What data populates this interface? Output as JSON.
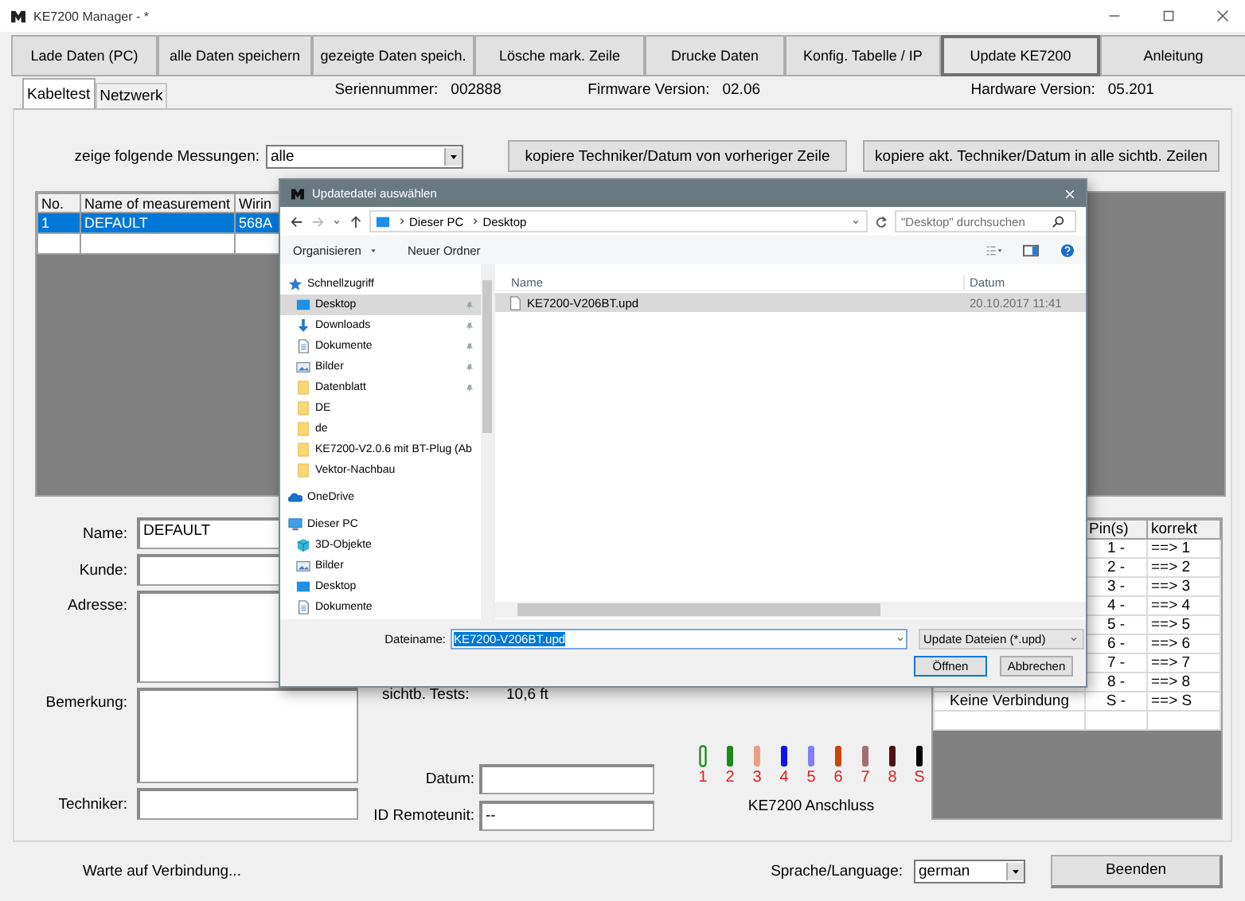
{
  "window": {
    "title": "KE7200 Manager - *"
  },
  "toolbar": [
    {
      "label": "Lade Daten (PC)",
      "selected": false
    },
    {
      "label": "alle Daten speichern",
      "selected": false
    },
    {
      "label": "gezeigte Daten speich.",
      "selected": false
    },
    {
      "label": "Lösche mark. Zeile",
      "selected": false
    },
    {
      "label": "Drucke Daten",
      "selected": false
    },
    {
      "label": "Konfig. Tabelle / IP",
      "selected": false
    },
    {
      "label": "Update KE7200",
      "selected": true
    },
    {
      "label": "Anleitung",
      "selected": false
    }
  ],
  "tabs": [
    {
      "label": "Kabeltest",
      "selected": true
    },
    {
      "label": "Netzwerk",
      "selected": false
    }
  ],
  "device_info": [
    {
      "label": "Seriennummer:",
      "value": "002888"
    },
    {
      "label": "Firmware Version:",
      "value": "02.06"
    },
    {
      "label": "Hardware Version:",
      "value": "05.201"
    }
  ],
  "filter": {
    "label": "zeige folgende Messungen:",
    "value": "alle"
  },
  "copy_buttons": [
    "kopiere Techniker/Datum von vorheriger Zeile",
    "kopiere akt. Techniker/Datum in alle sichtb. Zeilen"
  ],
  "measurements": {
    "columns": [
      "No.",
      "Name of measurement",
      "Wirin"
    ],
    "rows": [
      {
        "cells": [
          "1",
          "DEFAULT",
          "568A"
        ],
        "selected": true
      }
    ]
  },
  "form": [
    {
      "label": "Name:",
      "value": "DEFAULT",
      "kind": "line"
    },
    {
      "label": "Kunde:",
      "kind": "line"
    },
    {
      "label": "Adresse:",
      "kind": "area"
    },
    {
      "label": "Bemerkung:",
      "kind": "area"
    },
    {
      "label": "Techniker:",
      "kind": "line"
    }
  ],
  "tests": {
    "label": "sichtb. Tests:",
    "value": "10,6 ft"
  },
  "date_field": {
    "label": "Datum:"
  },
  "remote_unit": {
    "label": "ID Remoteunit:",
    "value": "--"
  },
  "connector": {
    "caption": "KE7200 Anschluss",
    "pins": [
      {
        "label": "1",
        "color": "#1a8a1a",
        "kind": "outline"
      },
      {
        "label": "2",
        "color": "#1a8a1a",
        "kind": "solid"
      },
      {
        "label": "3",
        "color": "#e8a080",
        "kind": "solid"
      },
      {
        "label": "4",
        "color": "#1010f0",
        "kind": "solid"
      },
      {
        "label": "5",
        "color": "#8080ff",
        "kind": "solid"
      },
      {
        "label": "6",
        "color": "#c84800",
        "kind": "solid"
      },
      {
        "label": "7",
        "color": "#a07070",
        "kind": "solid"
      },
      {
        "label": "8",
        "color": "#501010",
        "kind": "solid"
      },
      {
        "label": "S",
        "color": "#000000",
        "kind": "solid"
      }
    ]
  },
  "pin_table": {
    "columns": [
      "Pin(s)",
      "korrekt"
    ],
    "rows": [
      {
        "pins": "1 -",
        "correct": "==> 1"
      },
      {
        "pins": "2 -",
        "correct": "==> 2"
      },
      {
        "pins": "3 -",
        "correct": "==> 3"
      },
      {
        "pins": "4 -",
        "correct": "==> 4"
      },
      {
        "pins": "5 -",
        "correct": "==> 5"
      },
      {
        "pins": "6 -",
        "correct": "==> 6"
      },
      {
        "pins": "7 -",
        "correct": "==> 7"
      },
      {
        "pins": "8 -",
        "correct": "==> 8"
      },
      {
        "status": "Keine Verbindung",
        "pins": "S -",
        "correct": "==> S"
      }
    ]
  },
  "status_bar": {
    "message": "Warte auf Verbindung...",
    "language_label": "Sprache/Language:",
    "language": "german",
    "exit": "Beenden"
  },
  "dialog": {
    "title": "Updatedatei auswählen",
    "breadcrumb": [
      "Dieser PC",
      "Desktop"
    ],
    "search": {
      "placeholder": "\"Desktop\" durchsuchen"
    },
    "toolbar": [
      "Organisieren",
      "Neuer Ordner"
    ],
    "nav": [
      {
        "label": "Schnellzugriff",
        "kind": "star",
        "selected": false,
        "children": [
          {
            "label": "Desktop",
            "kind": "desktop",
            "selected": true,
            "pinned": true
          },
          {
            "label": "Downloads",
            "kind": "download",
            "selected": false,
            "pinned": true
          },
          {
            "label": "Dokumente",
            "kind": "document",
            "selected": false,
            "pinned": true
          },
          {
            "label": "Bilder",
            "kind": "pictures",
            "selected": false,
            "pinned": true
          },
          {
            "label": "Datenblatt",
            "kind": "folder",
            "selected": false,
            "pinned": true
          },
          {
            "label": "DE",
            "kind": "folder",
            "selected": false,
            "pinned": false
          },
          {
            "label": "de",
            "kind": "folder",
            "selected": false,
            "pinned": false
          },
          {
            "label": "KE7200-V2.0.6 mit BT-Plug (Ab",
            "kind": "folder",
            "selected": false,
            "pinned": false
          },
          {
            "label": "Vektor-Nachbau",
            "kind": "folder",
            "selected": false,
            "pinned": false
          }
        ]
      },
      {
        "label": "OneDrive",
        "kind": "cloud",
        "selected": false
      },
      {
        "label": "Dieser PC",
        "kind": "pc",
        "selected": false,
        "children": [
          {
            "label": "3D-Objekte",
            "kind": "cube",
            "selected": false,
            "pinned": false
          },
          {
            "label": "Bilder",
            "kind": "pictures",
            "selected": false,
            "pinned": false
          },
          {
            "label": "Desktop",
            "kind": "desktop",
            "selected": false,
            "pinned": false
          },
          {
            "label": "Dokumente",
            "kind": "document",
            "selected": false,
            "pinned": false
          }
        ]
      }
    ],
    "columns": [
      "Name",
      "Datum"
    ],
    "files": [
      {
        "name": "KE7200-V206BT.upd",
        "date": "20.10.2017 11:41",
        "selected": true
      }
    ],
    "file_name": {
      "label": "Dateiname:",
      "value": "KE7200-V206BT.upd",
      "selected": true
    },
    "file_type": "Update Dateien (*.upd)",
    "buttons": [
      {
        "label": "Öffnen",
        "default": true
      },
      {
        "label": "Abbrechen",
        "default": false
      }
    ]
  }
}
